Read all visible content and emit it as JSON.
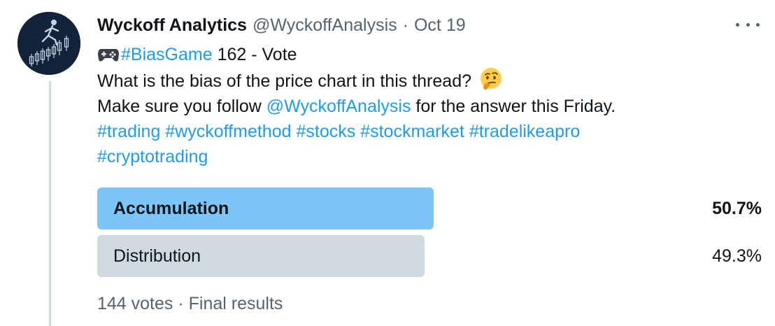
{
  "tweet": {
    "author_name": "Wyckoff Analytics",
    "author_handle": "@WyckoffAnalysis",
    "separator": "·",
    "date": "Oct 19",
    "more_icon": "more-horizontal-icon",
    "avatar_icon": "runner-on-candlesticks-logo",
    "lines": {
      "l1_hashtag": "#BiasGame",
      "l1_rest": " 162 - Vote",
      "l2_text": "What is the bias of the price chart in this thread?",
      "l3_pre": "Make sure you follow ",
      "l3_mention": "@WyckoffAnalysis",
      "l3_post": " for the answer this Friday.",
      "hashtags_row1": [
        "#trading",
        "#wyckoffmethod",
        "#stocks",
        "#stockmarket",
        "#tradelikeapro"
      ],
      "hashtags_row2": [
        "#cryptotrading"
      ]
    }
  },
  "poll": {
    "options": [
      {
        "label": "Accumulation",
        "percent_text": "50.7%",
        "percent": 50.7,
        "winner": true
      },
      {
        "label": "Distribution",
        "percent_text": "49.3%",
        "percent": 49.3,
        "winner": false
      }
    ],
    "votes_text": "144 votes",
    "separator": "·",
    "status_text": "Final results"
  },
  "colors": {
    "link": "#1d9bf0",
    "winner_bar": "#7cc5f7",
    "loser_bar": "#cfd9de",
    "secondary_text": "#536471"
  }
}
